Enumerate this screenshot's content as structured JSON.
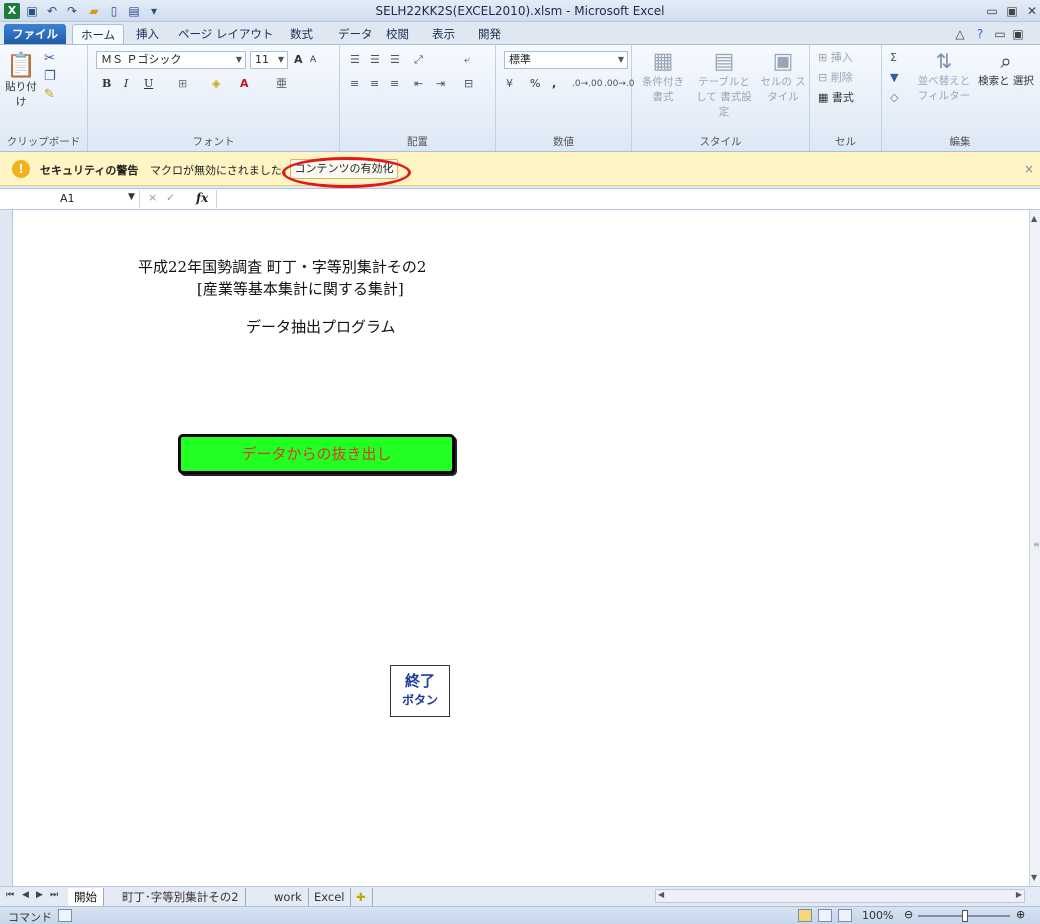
{
  "window": {
    "title": "SELH22KK2S(EXCEL2010).xlsm - Microsoft Excel",
    "app_icon": "X"
  },
  "quick_access": {
    "save_icon": "save-icon",
    "undo_icon": "undo-icon",
    "redo_icon": "redo-icon",
    "open_icon": "folder-open-icon",
    "new_icon": "new-document-icon",
    "preview_icon": "print-preview-icon"
  },
  "ribbon_tabs": [
    "ファイル",
    "ホーム",
    "挿入",
    "ページ レイアウト",
    "数式",
    "データ",
    "校閲",
    "表示",
    "開発"
  ],
  "ribbon": {
    "clipboard": {
      "label": "クリップボード",
      "paste": "貼り付け"
    },
    "font": {
      "label": "フォント",
      "font_name": "ＭＳ Ｐゴシック",
      "font_size": "11",
      "grow": "A",
      "shrink": "A",
      "bold": "B",
      "italic": "I",
      "underline": "U",
      "font_color": "A"
    },
    "alignment": {
      "label": "配置"
    },
    "number": {
      "label": "数値",
      "format": "標準",
      "percent": "%",
      "comma": ","
    },
    "styles": {
      "label": "スタイル",
      "conditional": "条件付き 書式",
      "as_table": "テーブルとして 書式設定",
      "cell_style": "セルの スタイル"
    },
    "cells": {
      "label": "セル",
      "insert": "挿入",
      "delete": "削除",
      "format": "書式"
    },
    "editing": {
      "label": "編集",
      "sum": "Σ",
      "sort_filter": "並べ替えと フィルター",
      "find_select": "検索と 選択"
    }
  },
  "security_bar": {
    "title": "セキュリティの警告",
    "message": "マクロが無効にされました。",
    "enable_button": "コンテンツの有効化",
    "close": "×"
  },
  "formula_bar": {
    "name_box": "A1",
    "fx": "fx",
    "formula": ""
  },
  "sheet": {
    "title_line1": "平成22年国勢調査 町丁・字等別集計その2",
    "title_line2": "[産業等基本集計に関する集計]",
    "program_title": "データ抽出プログラム",
    "extract_button": "データからの抜き出し",
    "exit_button_line1": "終了",
    "exit_button_line2": "ボタン"
  },
  "sheet_tabs": [
    "開始",
    "町丁･字等別集計その2",
    "work",
    "Excel"
  ],
  "status_bar": {
    "mode": "コマンド",
    "zoom": "100%"
  },
  "colors": {
    "extract_button_bg": "#22ff22",
    "extract_button_text": "#d93a2a",
    "security_bar_bg": "#fff5c4",
    "highlight_ring": "#e3181b"
  }
}
